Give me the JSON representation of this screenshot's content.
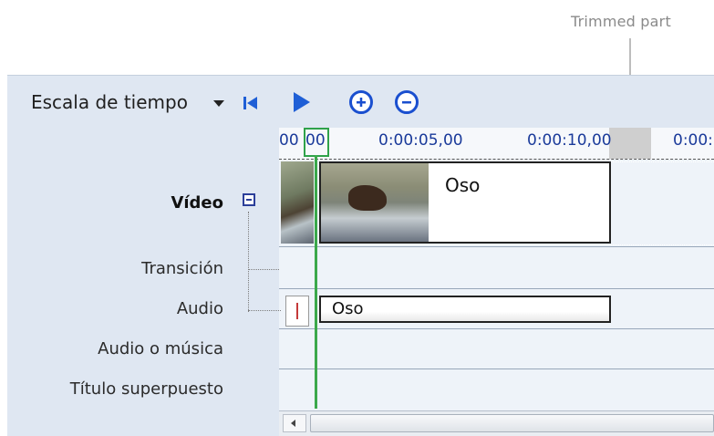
{
  "annotation": {
    "text": "Trimmed part"
  },
  "toolbar": {
    "view_label": "Escala de tiempo",
    "icons": [
      "dropdown-arrow-icon",
      "go-to-start-icon",
      "play-icon",
      "zoom-in-icon",
      "zoom-out-icon"
    ]
  },
  "ruler": {
    "start_a": "00",
    "start_b": "00",
    "mark_5": "0:00:05,00",
    "mark_10": "0:00:10,00",
    "mark_15": "0:00:"
  },
  "tracks": {
    "video": "Vídeo",
    "transition": "Transición",
    "audio": "Audio",
    "music": "Audio o música",
    "title_overlay": "Título superpuesto"
  },
  "clips": {
    "video_title": "Oso",
    "audio_title": "Oso"
  },
  "colors": {
    "playhead": "#3ba84b",
    "ruler_text": "#1a3a9a",
    "icon_blue": "#1f5fd6"
  }
}
